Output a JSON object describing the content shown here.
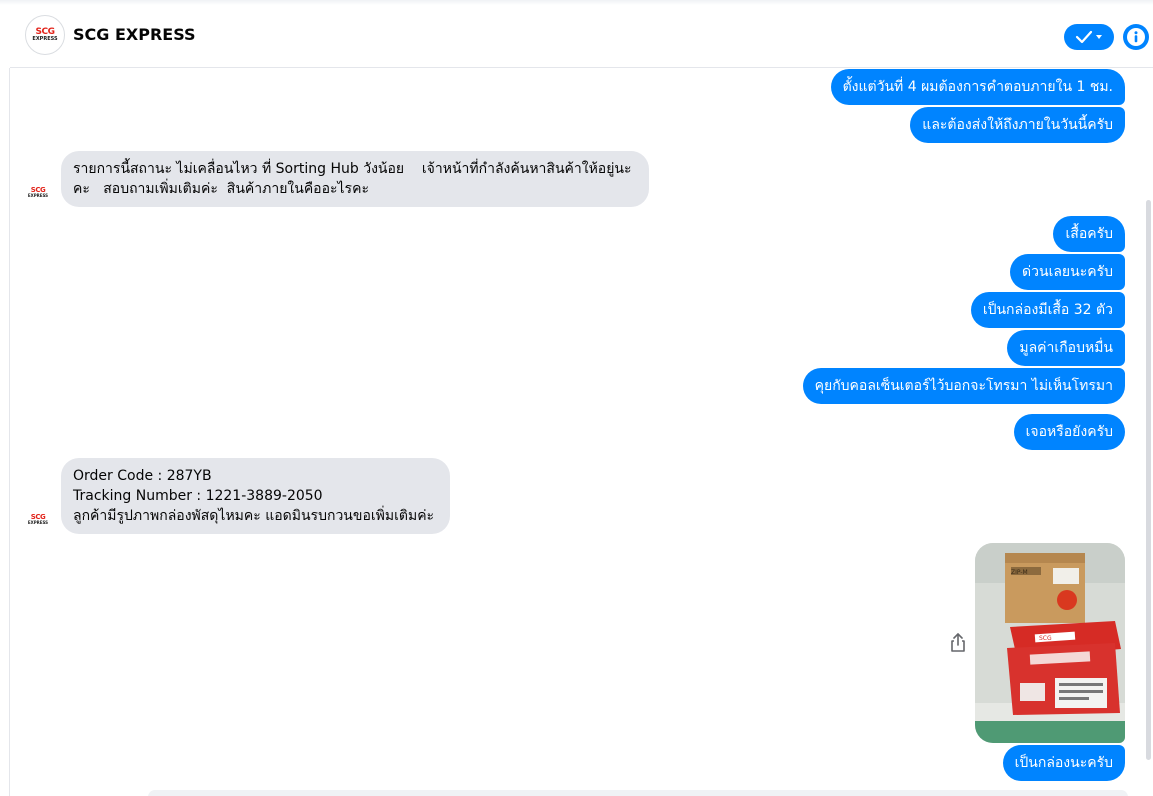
{
  "header": {
    "title": "SCG EXPRESS",
    "logo_text_top": "SCG",
    "logo_text_bottom": "EXPRESS",
    "check_icon": "check-icon",
    "info_icon": "info-icon"
  },
  "colors": {
    "accent": "#0084ff",
    "incoming_bubble": "#e4e6eb",
    "brand_red": "#e2231a"
  },
  "messages": [
    {
      "direction": "outgoing",
      "text": "ตั้งแต่วันที่ 4 ผมต้องการคำตอบภายใน 1 ชม."
    },
    {
      "direction": "outgoing",
      "text": "และต้องส่งให้ถึงภายในวันนี้ครับ"
    },
    {
      "direction": "incoming",
      "text": "รายการนี้สถานะ ไม่เคลื่อนไหว ที่ Sorting Hub วังน้อย    เจ้าหน้าที่กำลังค้นหาสินค้าให้อยู่นะ\nคะ   สอบถามเพิ่มเติมค่ะ  สินค้าภายในคืออะไรคะ"
    },
    {
      "direction": "outgoing",
      "text": "เสื้อครับ"
    },
    {
      "direction": "outgoing",
      "text": "ด่วนเลยนะครับ"
    },
    {
      "direction": "outgoing",
      "text": "เป็นกล่องมีเสื้อ 32 ตัว"
    },
    {
      "direction": "outgoing",
      "text": "มูลค่าเกือบหมื่น"
    },
    {
      "direction": "outgoing",
      "text": "คุยกับคอลเซ็นเตอร์ไว้บอกจะโทรมา ไม่เห็นโทรมา"
    },
    {
      "direction": "outgoing",
      "text": "เจอหรือยังครับ"
    },
    {
      "direction": "incoming",
      "text": "Order Code : 287YB\nTracking Number : 1221-3889-2050\nลูกค้ามีรูปภาพกล่องพัสดุไหมคะ แอดมินรบกวนขอเพิ่มเติมค่ะ"
    },
    {
      "direction": "outgoing",
      "type": "image",
      "image_label": "parcel-box-photo",
      "share_icon": "share-icon"
    },
    {
      "direction": "outgoing",
      "text": "เป็นกล่องนะครับ"
    }
  ],
  "photo": {
    "box_label": "ZIP-M",
    "sticker_text": "SCG"
  }
}
